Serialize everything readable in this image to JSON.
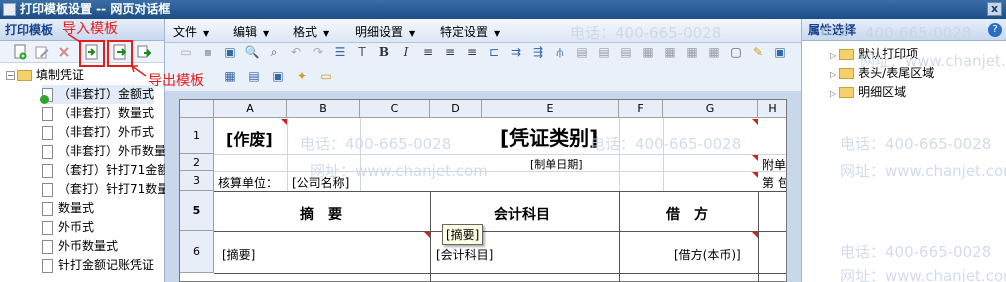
{
  "window": {
    "title": "打印模板设置 -- 网页对话框",
    "close_label": "x"
  },
  "left_panel": {
    "title": "打印模板",
    "tree": {
      "root": "填制凭证",
      "items": [
        "（非套打）金额式",
        "（非套打）数量式",
        "（非套打）外币式",
        "（非套打）外币数量",
        "（套打）针打71金额",
        "（套打）针打71数量",
        "数量式",
        "外币式",
        "外币数量式",
        "针打金额记账凭证"
      ]
    }
  },
  "menu": {
    "items": [
      "文件",
      "编辑",
      "格式",
      "明细设置",
      "特定设置"
    ]
  },
  "annotations": {
    "import": "导入模板",
    "export": "导出模板"
  },
  "sheet": {
    "columns": [
      "A",
      "B",
      "C",
      "D",
      "E",
      "F",
      "G",
      "H"
    ],
    "rows": [
      "1",
      "2",
      "3",
      "5",
      "6"
    ],
    "cells": {
      "void": "[作废]",
      "voucher_type": "[凭证类别]",
      "date": "[制单日期]",
      "attach": "附单",
      "unit": "核算单位：",
      "company": "[公司名称]",
      "page": "第 包",
      "summary_hdr": "摘　要",
      "account_hdr": "会计科目",
      "debit_hdr": "借　方",
      "summary": "[摘要]",
      "account": "[会计科目]",
      "debit": "[借方(本币)]"
    },
    "tooltip": "[摘要]"
  },
  "right_panel": {
    "title": "属性选择",
    "help_label": "?",
    "items": [
      "默认打印项",
      "表头/表尾区域",
      "明细区域"
    ]
  },
  "watermark": {
    "phone": "电话：400-665-0028",
    "site": "网址：www.chanjet.com"
  }
}
